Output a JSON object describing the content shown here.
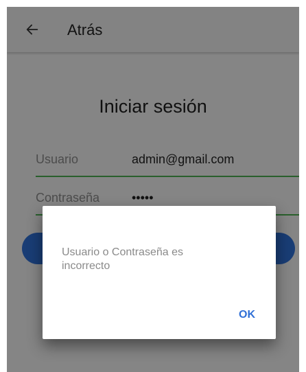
{
  "appbar": {
    "back_label": "Atrás",
    "back_icon": "arrow-left-icon"
  },
  "login": {
    "title": "Iniciar sesión",
    "username_label": "Usuario",
    "username_value": "admin@gmail.com",
    "password_label": "Contraseña",
    "password_value": "•••••"
  },
  "dialog": {
    "message": "Usuario o Contraseña es incorrecto",
    "ok_label": "OK"
  },
  "colors": {
    "accent": "#2f6fd6",
    "field_underline": "#4caf50",
    "scrim": "rgba(0,0,0,0.45)"
  }
}
